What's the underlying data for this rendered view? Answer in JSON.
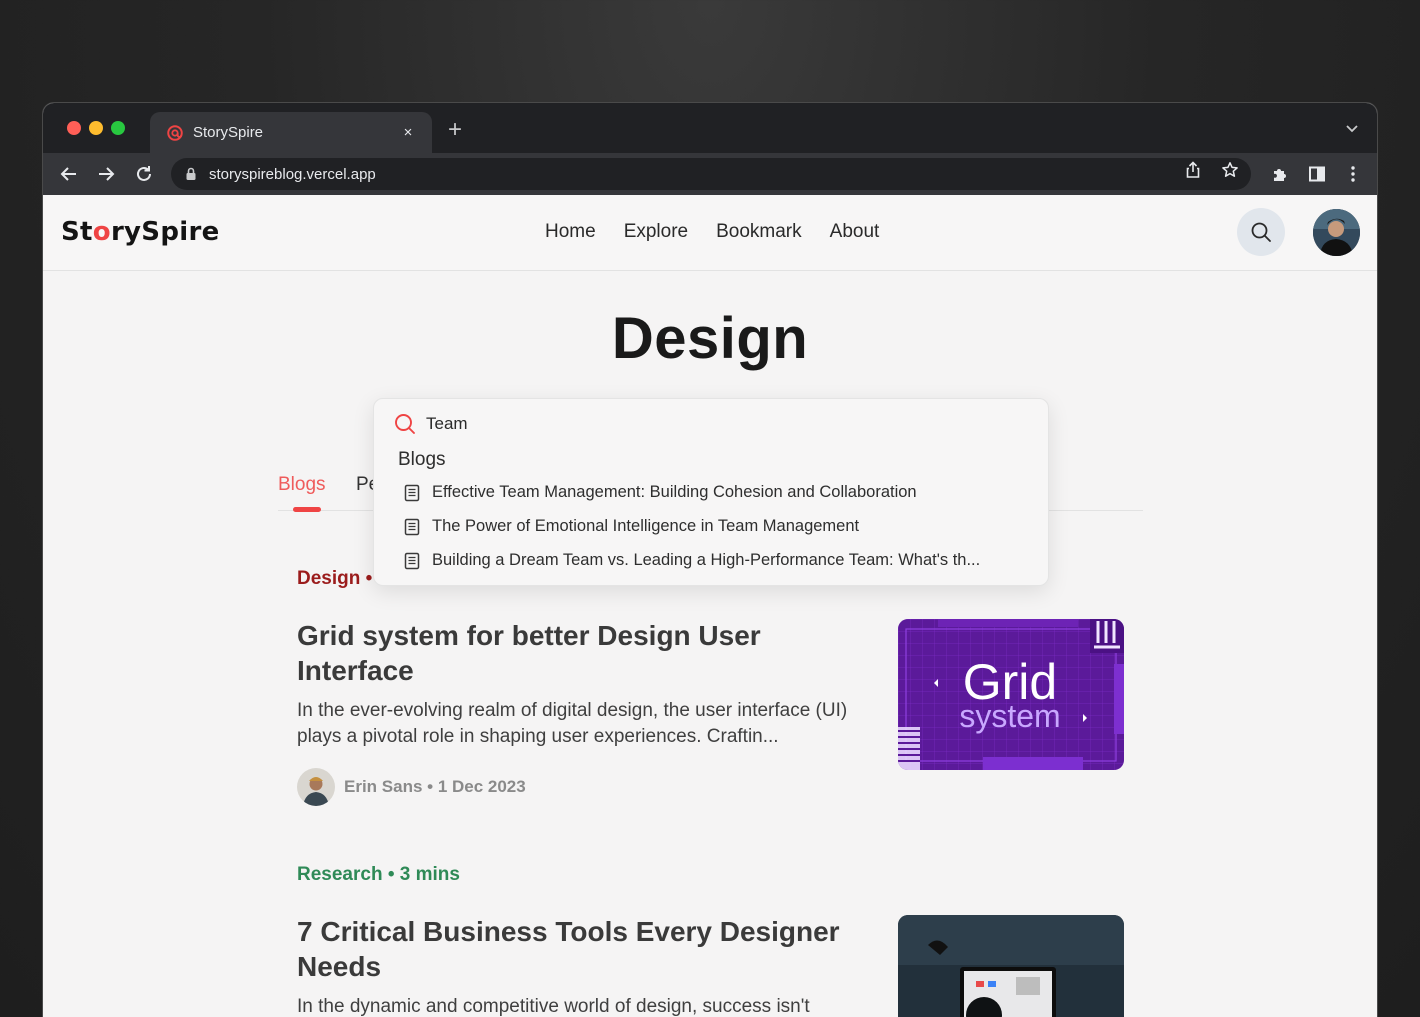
{
  "browser": {
    "tab_title": "StorySpire",
    "tab_close": "×",
    "new_tab": "+",
    "url": "storyspireblog.vercel.app"
  },
  "header": {
    "logo_start": "St",
    "logo_o": "o",
    "logo_end": "rySpire",
    "nav": [
      "Home",
      "Explore",
      "Bookmark",
      "About"
    ]
  },
  "page": {
    "title": "Design",
    "tabs": [
      "Blogs",
      "Pe"
    ]
  },
  "search": {
    "query": "Team",
    "section_heading": "Blogs",
    "results": [
      "Effective Team Management: Building Cohesion and Collaboration",
      "The Power of Emotional Intelligence in Team Management",
      "Building a Dream Team vs. Leading a High-Performance Team: What's th..."
    ]
  },
  "posts": [
    {
      "category": "Design •",
      "category_color": "#9b1c1c",
      "title": "Grid system for better Design User Interface",
      "excerpt": "In the ever-evolving realm of digital design, the user interface (UI) plays a pivotal role in shaping user experiences. Craftin...",
      "author_meta": "Erin Sans • 1 Dec 2023",
      "thumb_text_1": "Grid",
      "thumb_text_2": "system"
    },
    {
      "category": "Research • 3 mins",
      "category_color": "#2f8a57",
      "title": "7 Critical Business Tools Every Designer Needs",
      "excerpt": "In the dynamic and competitive world of design, success isn't"
    }
  ],
  "colors": {
    "accent": "#ef4444",
    "grid_thumb_bg": "#5b1a9a"
  }
}
